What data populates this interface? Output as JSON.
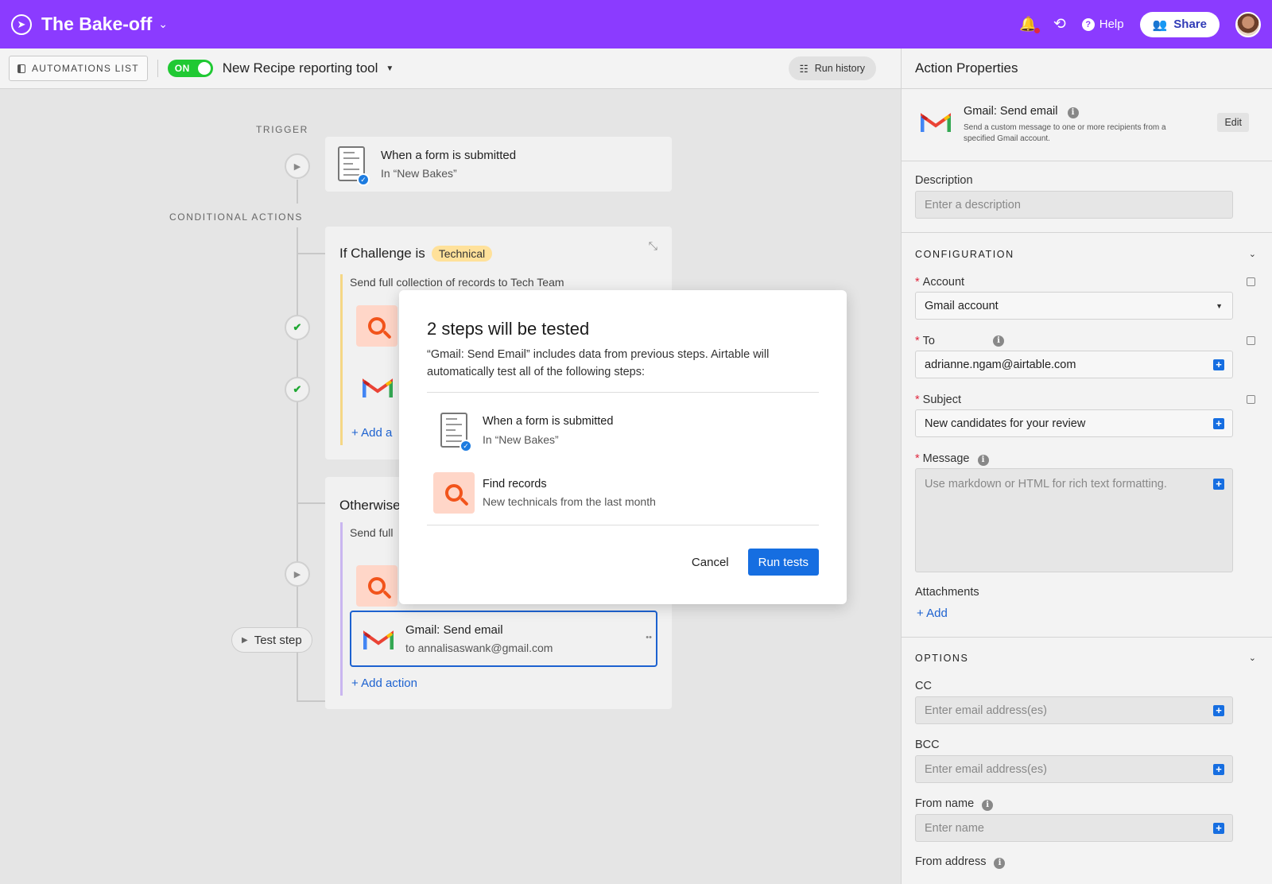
{
  "topbar": {
    "base_title": "The Bake-off",
    "help_label": "Help",
    "share_label": "Share"
  },
  "toolbar": {
    "automations_list_label": "AUTOMATIONS LIST",
    "toggle_label": "ON",
    "automation_name": "New Recipe reporting tool",
    "run_history_label": "Run history"
  },
  "canvas": {
    "trigger_label": "TRIGGER",
    "conditional_label": "CONDITIONAL ACTIONS",
    "trigger": {
      "title": "When a form is submitted",
      "subtitle": "In “New Bakes”"
    },
    "condition1": {
      "title": "If Challenge is",
      "tag": "Technical",
      "send_text": "Send full collection of records to Tech Team",
      "add_action": "+ Add a"
    },
    "condition2": {
      "title": "Otherwise",
      "send_text": "Send full",
      "gmail_title": "Gmail: Send email",
      "gmail_sub": "to annalisaswank@gmail.com",
      "add_action": "+ Add action"
    },
    "test_step_label": "Test step"
  },
  "modal": {
    "title": "2 steps will be tested",
    "description": "“Gmail: Send Email” includes data from previous steps. Airtable will automatically test all of the following steps:",
    "steps": [
      {
        "title": "When a form is submitted",
        "subtitle": "In “New Bakes”",
        "icon": "form-icon"
      },
      {
        "title": "Find records",
        "subtitle": "New technicals from the last month",
        "icon": "search-icon"
      }
    ],
    "cancel_label": "Cancel",
    "run_label": "Run tests"
  },
  "panel": {
    "title": "Action Properties",
    "action_name": "Gmail: Send email",
    "action_desc": "Send a custom message to one or more recipients from a specified Gmail account.",
    "edit_label": "Edit",
    "description_label": "Description",
    "description_placeholder": "Enter a description",
    "configuration_label": "CONFIGURATION",
    "account_label": "Account",
    "account_value": "Gmail account",
    "to_label": "To",
    "to_value": "adrianne.ngam@airtable.com",
    "subject_label": "Subject",
    "subject_value": "New candidates for your review",
    "message_label": "Message",
    "message_placeholder": "Use markdown or HTML for rich text formatting.",
    "attachments_label": "Attachments",
    "attachments_add": "+ Add",
    "options_label": "OPTIONS",
    "cc_label": "CC",
    "cc_placeholder": "Enter email address(es)",
    "bcc_label": "BCC",
    "bcc_placeholder": "Enter email address(es)",
    "from_name_label": "From name",
    "from_name_placeholder": "Enter name",
    "from_address_label": "From address"
  },
  "colors": {
    "brand_purple": "#8b3bff",
    "primary_blue": "#166ee1",
    "toggle_green": "#20c933",
    "tag_yellow": "#ffe19a",
    "search_orange": "#f2541b"
  }
}
